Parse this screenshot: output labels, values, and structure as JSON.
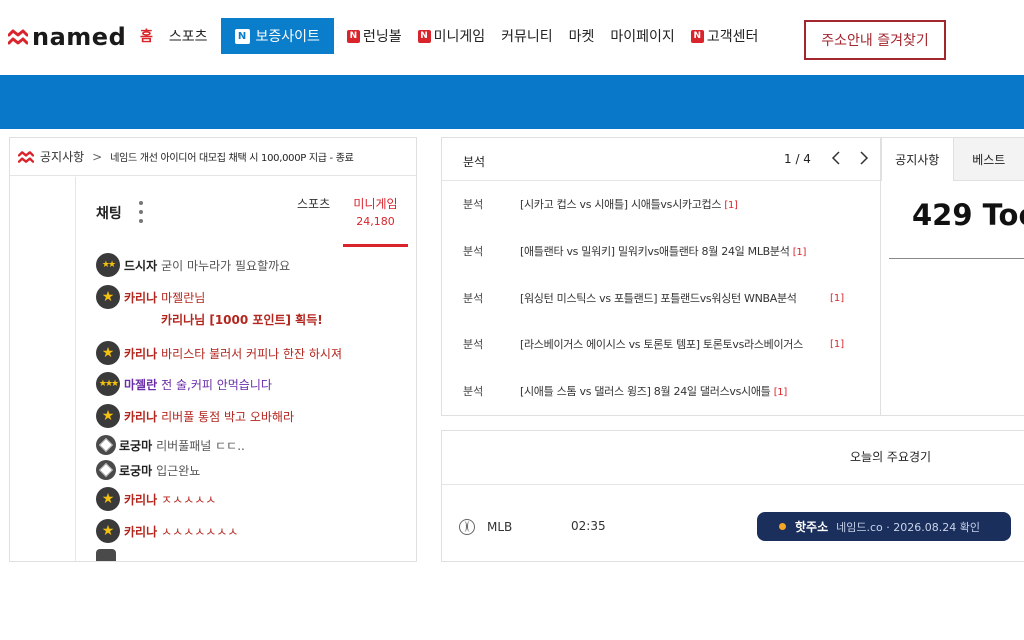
{
  "brand": {
    "name": "named",
    "accent": "#d9242b",
    "blue": "#0978c9"
  },
  "nav": {
    "items": [
      {
        "label": "홈",
        "active": true,
        "badge": ""
      },
      {
        "label": "스포츠",
        "active": false,
        "badge": ""
      },
      {
        "label": "보증사이트",
        "active": false,
        "badge": "N"
      },
      {
        "label": "런닝볼",
        "active": false,
        "badge": "N"
      },
      {
        "label": "미니게임",
        "active": false,
        "badge": "N"
      },
      {
        "label": "커뮤니티",
        "active": false,
        "badge": ""
      },
      {
        "label": "마켓",
        "active": false,
        "badge": ""
      },
      {
        "label": "마이페이지",
        "active": false,
        "badge": ""
      },
      {
        "label": "고객센터",
        "active": false,
        "badge": "N"
      }
    ],
    "bookmark_label": "주소안내 즐겨찾기"
  },
  "notice": {
    "label": "공지사항",
    "separator": ">",
    "text": "네임드 개선 아이디어 대모집 채택 시 100,000P 지급 - 종료"
  },
  "chat": {
    "title": "채팅",
    "tabs": {
      "sports": "스포츠",
      "mini": "미니게임",
      "mini_count": "24,180"
    },
    "messages": [
      {
        "nick": "드시자",
        "text": "굳이 마누라가 필요할까요"
      },
      {
        "nick": "카리나",
        "text": "마젤란님"
      },
      {
        "system": "카리나님 [1000 포인트] 획득!"
      },
      {
        "nick": "카리나",
        "text": "바리스타 불러서 커피나 한잔 하시져"
      },
      {
        "nick": "마젤란",
        "text": "전 술,커피 안먹습니다"
      },
      {
        "nick": "카리나",
        "text": "리버풀 통점 박고 오바해라"
      },
      {
        "nick": "로궁마",
        "text": "리버풀패널 ㄷㄷ.."
      },
      {
        "nick": "로궁마",
        "text": "입근완뇨"
      },
      {
        "nick": "카리나",
        "text": "ㅈㅅㅅㅅㅅ"
      },
      {
        "nick": "카리나",
        "text": "ㅅㅅㅅㅅㅅㅅㅅ"
      }
    ]
  },
  "analysis": {
    "title": "분석",
    "pager": "1 / 4",
    "rows": [
      {
        "cat": "분석",
        "text": "[시카고 컵스 vs 시애틀] 시애틀vs시카고컵스",
        "count": "[1]"
      },
      {
        "cat": "분석",
        "text": "[애틀랜타 vs 밀워키] 밀워키vs애틀랜타 8월 24일 MLB분석",
        "count": "[1]"
      },
      {
        "cat": "분석",
        "text": "[워싱턴 미스틱스 vs 포틀랜드] 포틀랜드vs워싱턴 WNBA분석",
        "count": "[1]"
      },
      {
        "cat": "분석",
        "text": "[라스베이거스 에이시스 vs 토론토 템포] 토론토vs라스베이거스",
        "count": "[1]"
      },
      {
        "cat": "분석",
        "text": "[시애틀 스톰 vs 댈러스 윙즈] 8월 24일 댈러스vs시애틀",
        "count": "[1]"
      }
    ]
  },
  "notice_panel": {
    "tabs": [
      "공지사항",
      "베스트"
    ],
    "big_text": "429 Too"
  },
  "games": {
    "title": "오늘의 주요경기",
    "rows": [
      {
        "league": "MLB",
        "time": "02:35"
      }
    ]
  },
  "toast": {
    "label": "핫주소",
    "info": "네임드.co · 2026.08.24 확인"
  }
}
